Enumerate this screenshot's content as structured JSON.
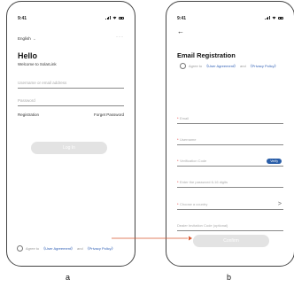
{
  "phone_a": {
    "status": {
      "time": "9:41"
    },
    "language": "English",
    "language_caret": "⌄",
    "more": "···",
    "greeting": "Hello",
    "welcome": "Welcome to SolarLink",
    "username_placeholder": "Username or email address",
    "password_placeholder": "Password",
    "registration_label": "Registration",
    "forgot_password_label": "Forget Password",
    "login_label": "Log In",
    "agree": {
      "prefix": "Agree to",
      "user_agreement": "《User Agreement》",
      "and": "and",
      "privacy_policy": "《Privacy Policy》"
    }
  },
  "phone_b": {
    "status": {
      "time": "9:41"
    },
    "back_icon": "←",
    "title": "Email Registration",
    "agree": {
      "prefix": "Agree to",
      "user_agreement": "《User Agreement》",
      "and": "and",
      "privacy_policy": "《Privacy Policy》"
    },
    "required_mark": "*",
    "email_placeholder": "Email",
    "username_placeholder": "Username",
    "verification_placeholder": "Verification Code",
    "verify_label": "Verify",
    "password_placeholder": "Enter the password 6-16 digits",
    "country_placeholder": "Choose a country",
    "country_chevron": ">",
    "invitation_placeholder": "Dealer Invitation Code (optional)",
    "confirm_label": "Confirm"
  },
  "captions": {
    "a": "a",
    "b": "b"
  },
  "colors": {
    "link": "#2f5fb5",
    "verify_button": "#2a5ea8",
    "disabled_button": "#e3e3e3",
    "arrow": "#d9572f",
    "required": "#dd2222"
  }
}
